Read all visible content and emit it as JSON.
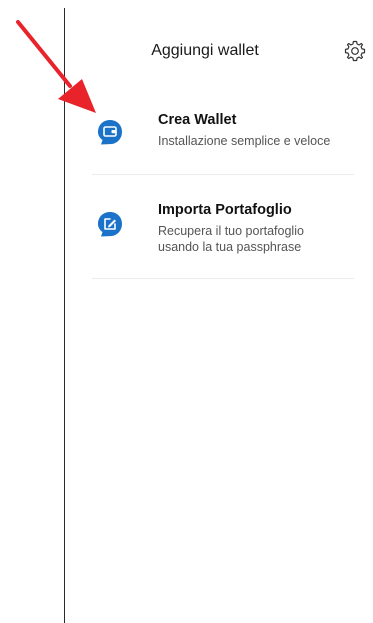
{
  "header": {
    "title": "Aggiungi wallet",
    "settings_icon": "gear-icon"
  },
  "options": [
    {
      "title": "Crea Wallet",
      "subtitle": "Installazione semplice e veloce",
      "icon": "wallet-icon"
    },
    {
      "title": "Importa Portafoglio",
      "subtitle": "Recupera il tuo portafoglio usando la tua passphrase",
      "icon": "edit-icon"
    }
  ],
  "colors": {
    "icon_blue": "#1a73c8",
    "annotation_arrow": "#e8232a"
  }
}
